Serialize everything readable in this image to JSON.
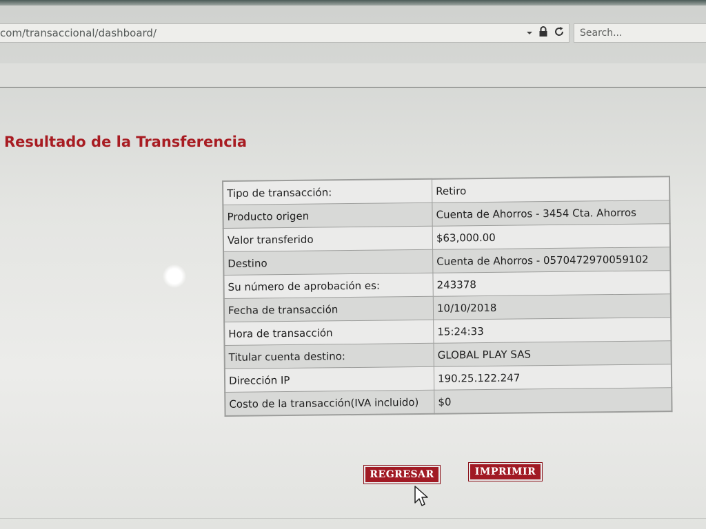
{
  "browser": {
    "url": "com/transaccional/dashboard/",
    "search_placeholder": "Search..."
  },
  "page": {
    "title": "Resultado de la Transferencia"
  },
  "result_table": {
    "rows": [
      {
        "label": "Tipo de transacción:",
        "value": "Retiro"
      },
      {
        "label": "Producto origen",
        "value": "Cuenta de Ahorros - 3454 Cta. Ahorros"
      },
      {
        "label": "Valor transferido",
        "value": "$63,000.00"
      },
      {
        "label": "Destino",
        "value": "Cuenta de Ahorros - 0570472970059102"
      },
      {
        "label": "Su número de aprobación es:",
        "value": "243378"
      },
      {
        "label": "Fecha de transacción",
        "value": "10/10/2018"
      },
      {
        "label": "Hora de transacción",
        "value": "15:24:33"
      },
      {
        "label": "Titular cuenta destino:",
        "value": "GLOBAL PLAY SAS"
      },
      {
        "label": "Dirección IP",
        "value": "190.25.122.247"
      },
      {
        "label": "Costo de la transacción(IVA incluido)",
        "value": "$0"
      }
    ]
  },
  "actions": {
    "back_label": "REGRESAR",
    "print_label": "IMPRIMIR"
  },
  "colors": {
    "accent": "#a81c22",
    "button": "#a11a24"
  },
  "icons": [
    "dropdown-arrow-icon",
    "lock-icon",
    "reload-icon",
    "mouse-cursor-icon"
  ]
}
